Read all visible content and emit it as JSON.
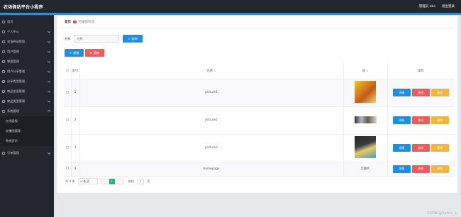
{
  "app": {
    "title": "农场驿站平台小程序"
  },
  "header": {
    "admin_label": "管理员 abo",
    "logout_label": "退出登录"
  },
  "sidebar": {
    "items": [
      {
        "label": "首页"
      },
      {
        "label": "个人中心"
      },
      {
        "label": "农场驿站管理"
      },
      {
        "label": "用户管理"
      },
      {
        "label": "果蔬管理"
      },
      {
        "label": "用户分享管理"
      },
      {
        "label": "分享类型管理"
      },
      {
        "label": "商品信息管理"
      },
      {
        "label": "商品类型管理"
      },
      {
        "label": "系统管理"
      }
    ],
    "subitems": [
      {
        "label": "在线客服"
      },
      {
        "label": "轮播图管理"
      },
      {
        "label": "系统资讯"
      }
    ],
    "orders": {
      "label": "订单管理"
    }
  },
  "breadcrumb": {
    "home": "首页",
    "current": "轮播图管理"
  },
  "search": {
    "label": "名称",
    "placeholder": "名称",
    "button": "查询"
  },
  "actions": {
    "add": "新增",
    "delete": "删除"
  },
  "table": {
    "headers": {
      "index": "索引",
      "name": "名称",
      "image": "值"
    },
    "ops_header": "操作",
    "rows": [
      {
        "index": "1",
        "name": "picture1",
        "image": "thumb1",
        "image_text": ""
      },
      {
        "index": "2",
        "name": "picture2",
        "image": "thumb2",
        "image_text": ""
      },
      {
        "index": "3",
        "name": "picture3",
        "image": "thumb3",
        "image_text": ""
      },
      {
        "index": "4",
        "name": "homepage",
        "image": "",
        "image_text": "无图片"
      }
    ],
    "ops": {
      "view": "详情",
      "edit": "修改",
      "del": "删除"
    }
  },
  "pager": {
    "total": "共 4 条",
    "page_size": "10条/页",
    "current_page": "1",
    "goto_label": "前往",
    "goto_value": "1",
    "page_suffix": "页"
  },
  "watermark": "CSDN @Seline_a"
}
